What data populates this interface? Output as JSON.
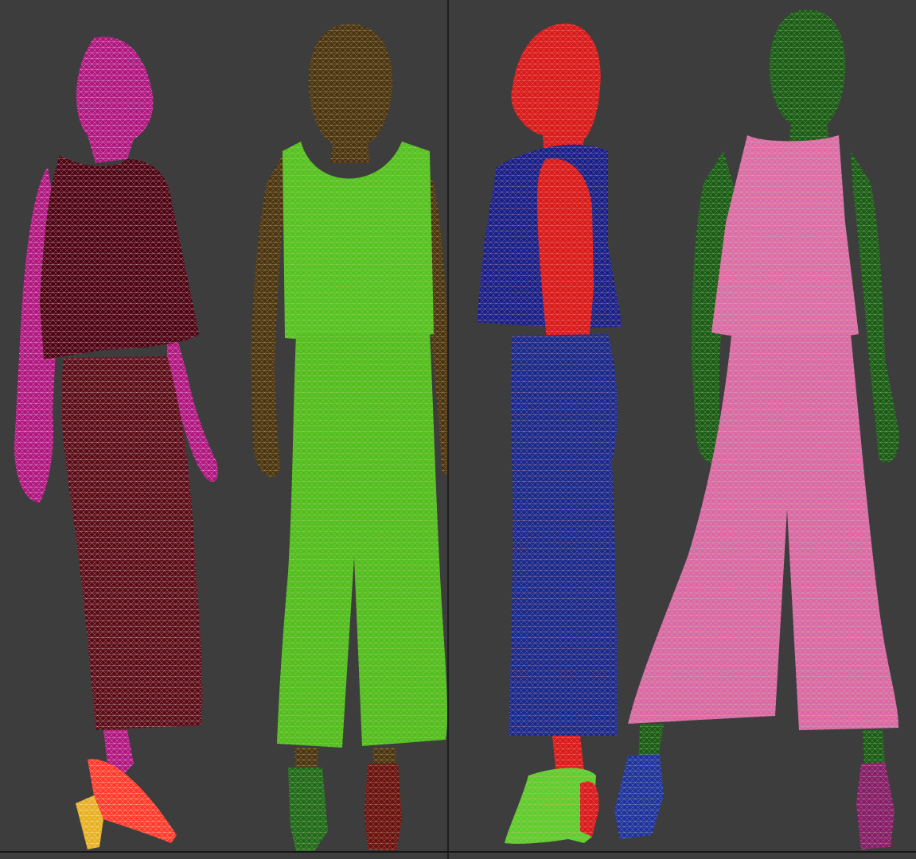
{
  "scene": {
    "background_color": "#3d3d3d",
    "divider_color": "#1e1e1e",
    "viewports": [
      {
        "name": "left-viewport",
        "figures": [
          {
            "name": "figure-magenta-side",
            "view": "side",
            "skin_color": "#b0157f",
            "top_color": "#4d0010",
            "pants_color": "#5a0a14",
            "shoe_color": "#ff3a2a",
            "shoe_accent_color": "#e8b020",
            "mesh_color": "#ffffff"
          },
          {
            "name": "figure-brown-front",
            "view": "front",
            "skin_color": "#4a3410",
            "top_color": "#52c41f",
            "pants_color": "#4fbf1c",
            "shoe_color": "#1d6b1a",
            "shoe_accent_color": "#6a1010",
            "mesh_color": "#d9c9a0"
          }
        ]
      },
      {
        "name": "right-viewport",
        "figures": [
          {
            "name": "figure-red-side",
            "view": "side",
            "skin_color": "#d81a1a",
            "top_color": "#14208a",
            "pants_color": "#152a8c",
            "shoe_color": "#5ad02a",
            "shoe_accent_color": "#d81a1a",
            "mesh_color": "#ffb0b0"
          },
          {
            "name": "figure-green-back",
            "view": "back",
            "skin_color": "#1a5a14",
            "top_color": "#e06aa8",
            "pants_color": "#de66a6",
            "shoe_color": "#2030a0",
            "shoe_accent_color": "#8a1a6a",
            "mesh_color": "#b8e0b0"
          }
        ]
      }
    ]
  }
}
